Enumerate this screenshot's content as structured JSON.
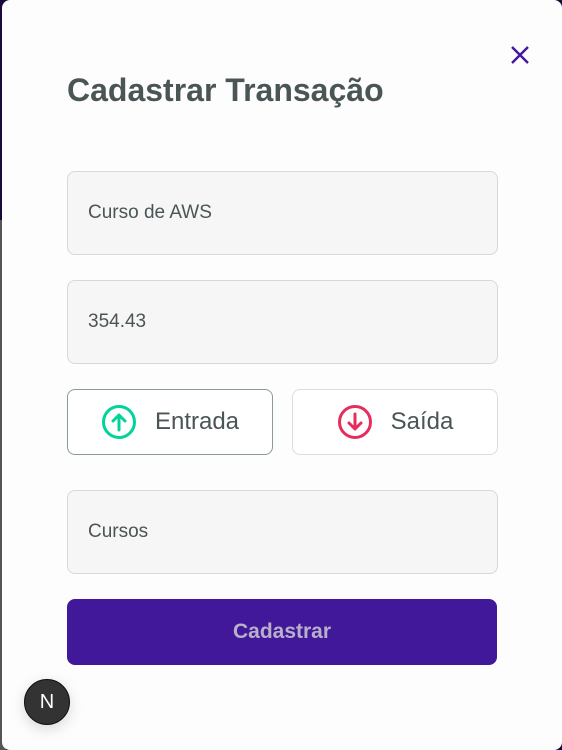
{
  "modal": {
    "title": "Cadastrar Transação",
    "close_icon": "close-icon"
  },
  "form": {
    "description": "Curso de AWS",
    "price": "354.43",
    "types": [
      {
        "label": "Entrada",
        "icon": "arrow-circle-up-icon",
        "color": "#00b37e"
      },
      {
        "label": "Saída",
        "icon": "arrow-circle-down-icon",
        "color": "#e52e4d"
      }
    ],
    "category": "Cursos",
    "submit_label": "Cadastrar"
  },
  "badge": {
    "label": "N"
  },
  "colors": {
    "accent": "#42189b",
    "text": "#4a5555"
  }
}
